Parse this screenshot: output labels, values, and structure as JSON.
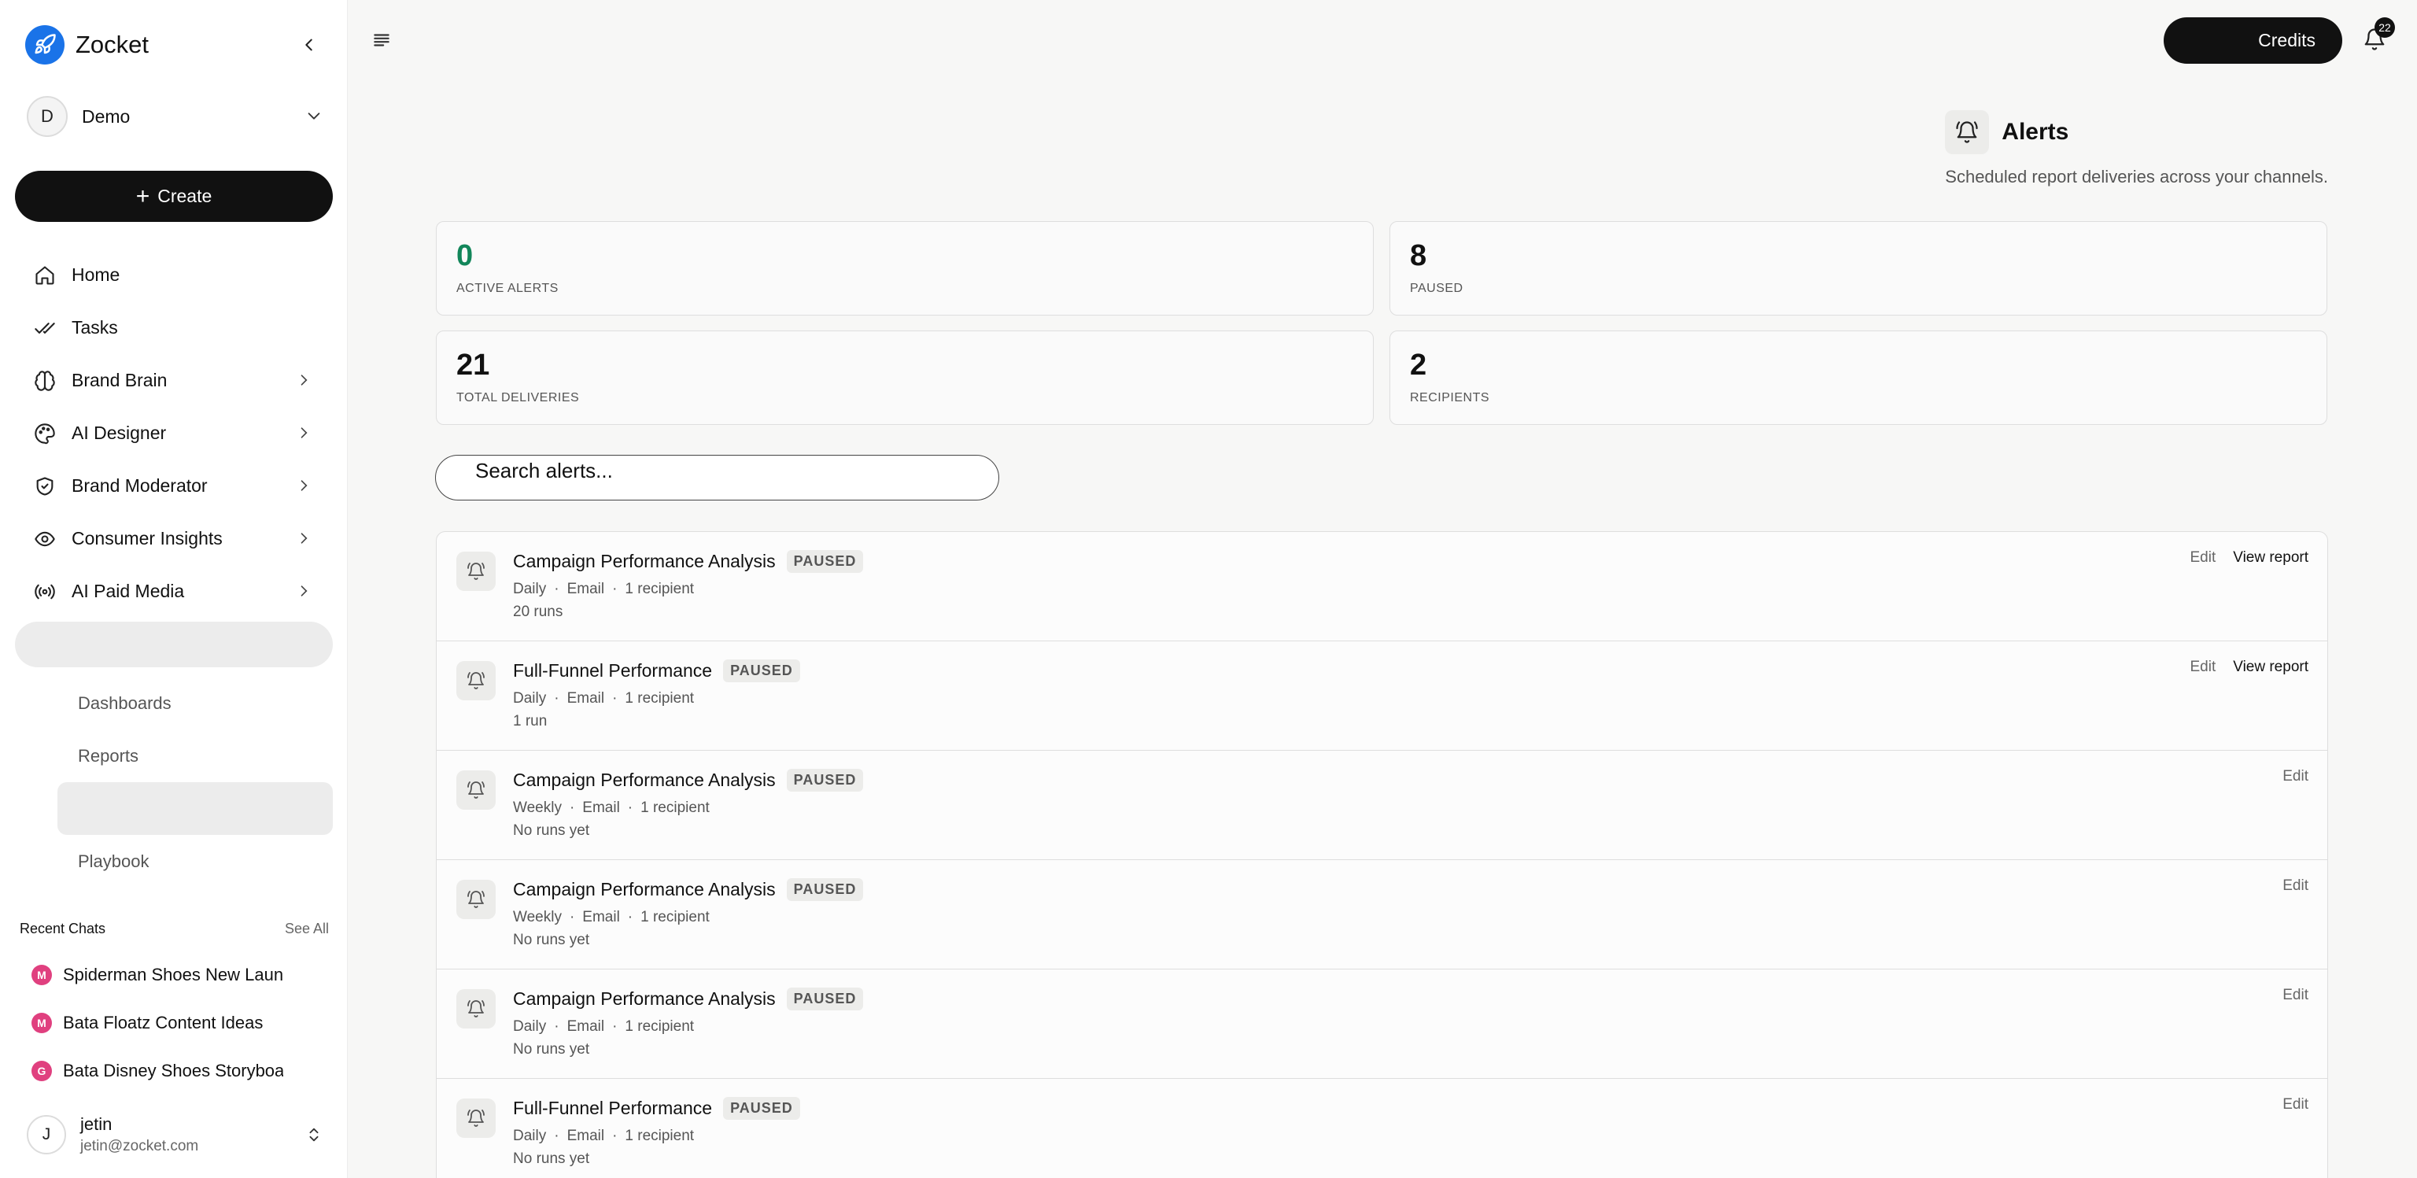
{
  "app": {
    "name": "Zocket"
  },
  "workspace": {
    "initial": "D",
    "name": "Demo"
  },
  "create_label": "Create",
  "nav": [
    {
      "label": "Home",
      "icon": "home-icon",
      "chevron": false
    },
    {
      "label": "Tasks",
      "icon": "check-double-icon",
      "chevron": false
    },
    {
      "label": "Brand Brain",
      "icon": "brain-icon",
      "chevron": true
    },
    {
      "label": "AI Designer",
      "icon": "palette-icon",
      "chevron": true
    },
    {
      "label": "Brand Moderator",
      "icon": "shield-check-icon",
      "chevron": true
    },
    {
      "label": "Consumer Insights",
      "icon": "eye-icon",
      "chevron": true
    },
    {
      "label": "AI Paid Media",
      "icon": "broadcast-icon",
      "chevron": true
    }
  ],
  "subnav": [
    {
      "label": "Dashboards",
      "active": false
    },
    {
      "label": "Reports",
      "active": false
    },
    {
      "label": "",
      "active": true
    },
    {
      "label": "Playbook",
      "active": false
    }
  ],
  "recent": {
    "title": "Recent Chats",
    "see_all": "See All",
    "items": [
      {
        "badge": "M",
        "label": "Spiderman Shoes New Launch"
      },
      {
        "badge": "M",
        "label": "Bata Floatz Content Ideas"
      },
      {
        "badge": "G",
        "label": "Bata Disney Shoes Storyboard"
      }
    ]
  },
  "user": {
    "initial": "J",
    "name": "jetin",
    "email": "jetin@zocket.com"
  },
  "topbar": {
    "credits_label": "Credits",
    "notification_count": "22"
  },
  "page": {
    "title": "Alerts",
    "subtitle": "Scheduled report deliveries across your channels."
  },
  "stats": [
    {
      "value": "0",
      "label": "ACTIVE ALERTS",
      "color": "#12865a"
    },
    {
      "value": "8",
      "label": "PAUSED"
    },
    {
      "value": "21",
      "label": "TOTAL DELIVERIES"
    },
    {
      "value": "2",
      "label": "RECIPIENTS"
    }
  ],
  "search": {
    "placeholder": "Search alerts..."
  },
  "alerts": [
    {
      "title": "Campaign Performance Analysis",
      "status": "PAUSED",
      "frequency": "Daily",
      "channel": "Email",
      "recipients": "1 recipient",
      "runs": "20 runs",
      "edit": "Edit",
      "view": "View report"
    },
    {
      "title": "Full-Funnel Performance",
      "status": "PAUSED",
      "frequency": "Daily",
      "channel": "Email",
      "recipients": "1 recipient",
      "runs": "1 run",
      "edit": "Edit",
      "view": "View report"
    },
    {
      "title": "Campaign Performance Analysis",
      "status": "PAUSED",
      "frequency": "Weekly",
      "channel": "Email",
      "recipients": "1 recipient",
      "runs": "No runs yet",
      "edit": "Edit",
      "view": ""
    },
    {
      "title": "Campaign Performance Analysis",
      "status": "PAUSED",
      "frequency": "Weekly",
      "channel": "Email",
      "recipients": "1 recipient",
      "runs": "No runs yet",
      "edit": "Edit",
      "view": ""
    },
    {
      "title": "Campaign Performance Analysis",
      "status": "PAUSED",
      "frequency": "Daily",
      "channel": "Email",
      "recipients": "1 recipient",
      "runs": "No runs yet",
      "edit": "Edit",
      "view": ""
    },
    {
      "title": "Full-Funnel Performance",
      "status": "PAUSED",
      "frequency": "Daily",
      "channel": "Email",
      "recipients": "1 recipient",
      "runs": "No runs yet",
      "edit": "Edit",
      "view": ""
    }
  ],
  "colors": {
    "accent": "#111111",
    "brand": "#1a73e8",
    "active_green": "#12865a",
    "chat_badge": "#e0407f"
  }
}
